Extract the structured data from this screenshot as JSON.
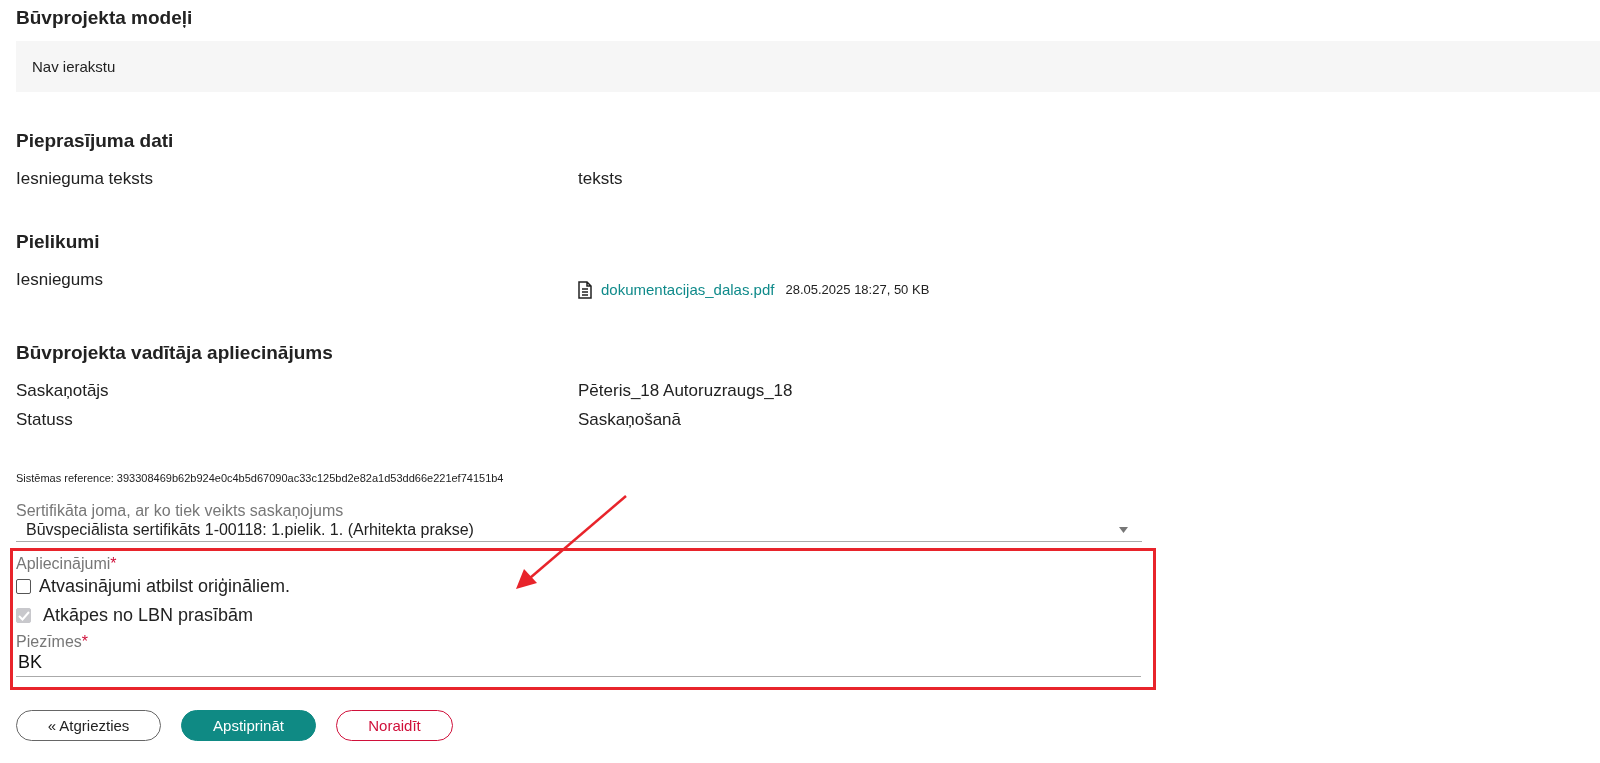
{
  "sections": [
    {
      "kind": "empty",
      "title": "Būvprojekta modeļi",
      "empty_text": "Nav ierakstu"
    },
    {
      "kind": "fields",
      "title": "Pieprasījuma dati",
      "rows": [
        {
          "label": "Iesnieguma teksts",
          "value": "teksts"
        }
      ]
    },
    {
      "kind": "attachments",
      "title": "Pielikumi",
      "rows": [
        {
          "label": "Iesniegums",
          "file": "dokumentacijas_dalas.pdf",
          "meta": "28.05.2025 18:27, 50 KB"
        }
      ]
    },
    {
      "kind": "fields",
      "title": "Būvprojekta vadītāja apliecinājums",
      "rows": [
        {
          "label": "Saskaņotājs",
          "value": "Pēteris_18 Autoruzraugs_18"
        },
        {
          "label": "Statuss",
          "value": "Saskaņošanā"
        }
      ]
    }
  ],
  "reference": "Sistēmas reference: 393308469b62b924e0c4b5d67090ac33c125bd2e82a1d53dd66e221ef74151b4",
  "certificate_select": {
    "label": "Sertifikāta joma, ar ko tiek veikts saskaņojums",
    "value": "Būvspeciālista sertifikāts 1-00118: 1.pielik. 1. (Arhitekta prakse)"
  },
  "confirmations": {
    "label": "Apliecinājumi",
    "required_mark": "*",
    "items": [
      {
        "label": "Atvasinājumi atbilst oriģināliem.",
        "checked": false,
        "disabled": false
      },
      {
        "label": "Atkāpes no LBN prasībām",
        "checked": true,
        "disabled": true
      }
    ]
  },
  "notes": {
    "label": "Piezīmes",
    "required_mark": "*",
    "value": "BK"
  },
  "buttons": [
    {
      "label": "« Atgriezties",
      "kind": "outline"
    },
    {
      "label": "Apstiprināt",
      "kind": "primary"
    },
    {
      "label": "Noraidīt",
      "kind": "danger"
    }
  ]
}
